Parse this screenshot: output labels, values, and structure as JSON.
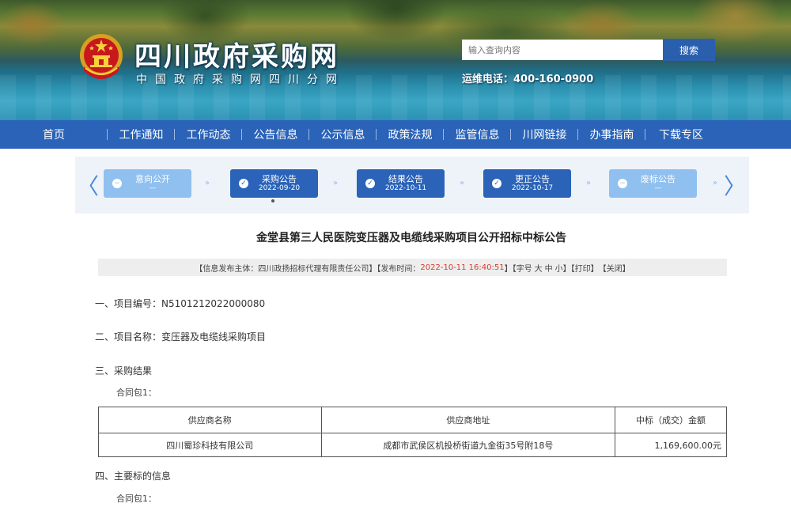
{
  "header": {
    "title": "四川政府采购网",
    "subtitle": "中国政府采购网四川分网",
    "search_placeholder": "输入查询内容",
    "search_button": "搜索",
    "hotline": "运维电话：400-160-0900"
  },
  "nav": {
    "items": [
      "首页",
      "工作通知",
      "工作动态",
      "公告信息",
      "公示信息",
      "政策法规",
      "监管信息",
      "川网链接",
      "办事指南",
      "下载专区"
    ]
  },
  "steps": {
    "prev_arrow": "〈",
    "next_arrow": "〉",
    "items": [
      {
        "label": "意向公开",
        "date": "—",
        "status": "pending"
      },
      {
        "label": "采购公告",
        "date": "2022-09-20",
        "status": "done"
      },
      {
        "label": "结果公告",
        "date": "2022-10-11",
        "status": "done"
      },
      {
        "label": "更正公告",
        "date": "2022-10-17",
        "status": "done"
      },
      {
        "label": "废标公告",
        "date": "—",
        "status": "pending"
      }
    ]
  },
  "article": {
    "title": "金堂县第三人民医院变压器及电缆线采购项目公开招标中标公告",
    "meta": {
      "publisher_prefix": "【信息发布主体：",
      "publisher": "四川政扬招标代理有限责任公司",
      "time_prefix": "】【发布时间：",
      "time": "2022-10-11 16:40:51",
      "font_prefix": "】【字号",
      "font_large": "大",
      "font_medium": "中",
      "font_small": "小",
      "print": "】【打印】",
      "close": "【关闭】"
    },
    "sections": {
      "s1": "一、项目编号：N5101212022000080",
      "s2": "二、项目名称：变压器及电缆线采购项目",
      "s3": "三、采购结果",
      "s3_sub": "合同包1：",
      "s4": "四、主要标的信息",
      "s4_sub": "合同包1："
    },
    "table": {
      "headers": [
        "供应商名称",
        "供应商地址",
        "中标（成交）金额"
      ],
      "rows": [
        [
          "四川蜀珍科技有限公司",
          "成都市武侯区机投桥街道九金街35号附18号",
          "1,169,600.00元"
        ]
      ]
    }
  },
  "colors": {
    "nav_bg": "#2a63b8",
    "step_done": "#2a63b8",
    "step_pending": "#8fc0ef",
    "time_red": "#d63b2f",
    "search_button": "#2a5fae"
  },
  "icons": [
    "national-emblem-icon",
    "check-icon",
    "minus-icon",
    "double-chevron-right-icon",
    "chevron-left-icon",
    "chevron-right-icon"
  ]
}
